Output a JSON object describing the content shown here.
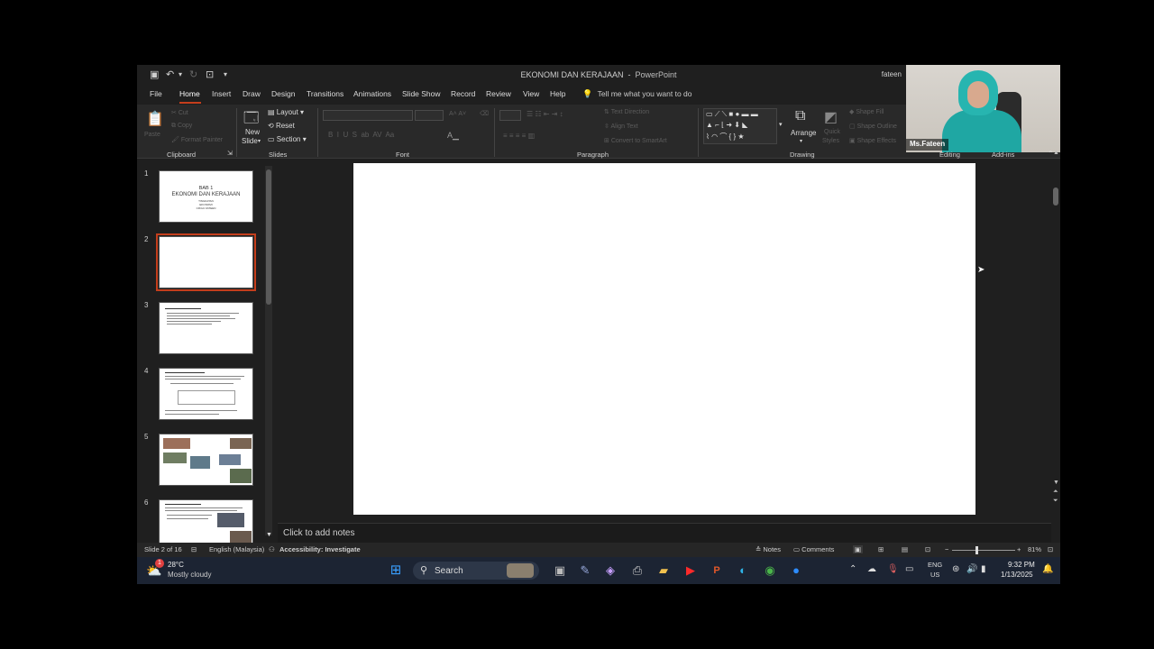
{
  "window": {
    "doc_title": "EKONOMI DAN KERAJAAN",
    "app_name": "PowerPoint",
    "user": "fateen"
  },
  "tabs": [
    "File",
    "Home",
    "Insert",
    "Draw",
    "Design",
    "Transitions",
    "Animations",
    "Slide Show",
    "Record",
    "Review",
    "View",
    "Help"
  ],
  "active_tab": "Home",
  "tell_me": "Tell me what you want to do",
  "ribbon": {
    "clipboard": {
      "label": "Clipboard",
      "paste": "Paste",
      "cut": "Cut",
      "copy": "Copy",
      "format_painter": "Format Painter"
    },
    "slides": {
      "label": "Slides",
      "new_slide": "New",
      "new_slide2": "Slide",
      "layout": "Layout",
      "reset": "Reset",
      "section": "Section"
    },
    "font": {
      "label": "Font"
    },
    "paragraph": {
      "label": "Paragraph",
      "text_direction": "Text Direction",
      "align_text": "Align Text",
      "convert_smartart": "Convert to SmartArt"
    },
    "drawing": {
      "label": "Drawing",
      "arrange": "Arrange",
      "quick_styles": "Quick",
      "quick_styles2": "Styles",
      "shape_fill": "Shape Fill",
      "shape_outline": "Shape Outline",
      "shape_effects": "Shape Effects"
    },
    "editing": {
      "label": "Editing"
    },
    "addins": {
      "label": "Add-ins"
    }
  },
  "webcam": {
    "name": "Ms.Fateen"
  },
  "slides": [
    {
      "num": "1",
      "title_line1": "BAB 1",
      "title_line2": "EKONOMI DAN KERAJAAN",
      "sub1": "TINGKATAN",
      "sub2": "EKONOMI",
      "sub3": "CIKGU FATEEN"
    },
    {
      "num": "2"
    },
    {
      "num": "3"
    },
    {
      "num": "4"
    },
    {
      "num": "5"
    },
    {
      "num": "6"
    }
  ],
  "selected_slide": 2,
  "notes_placeholder": "Click to add notes",
  "status": {
    "slide_of": "Slide 2 of 16",
    "language": "English (Malaysia)",
    "accessibility": "Accessibility: Investigate",
    "notes": "Notes",
    "comments": "Comments",
    "zoom": "81%"
  },
  "taskbar": {
    "weather_temp": "28°C",
    "weather_desc": "Mostly cloudy",
    "search": "Search",
    "lang1": "ENG",
    "lang2": "US",
    "time": "9:32 PM",
    "date": "1/13/2025",
    "notification_badge": "1"
  },
  "colors": {
    "accent": "#c43e1c",
    "powerpoint": "#c43e1c",
    "taskbar": "#1c2433"
  }
}
